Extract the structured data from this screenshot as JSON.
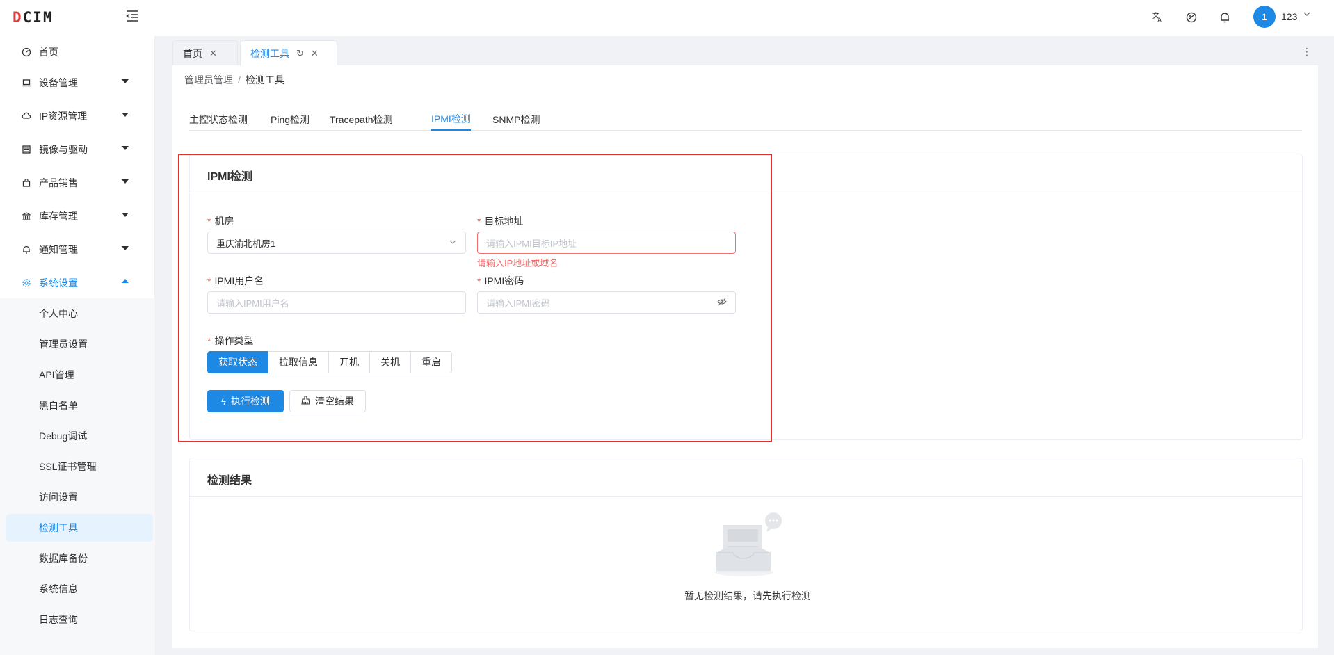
{
  "app": {
    "logo_text": "DCIM",
    "username": "123",
    "avatar_text": "1"
  },
  "header_icons": [
    "translate-icon",
    "theme-icon",
    "bell-icon"
  ],
  "sidebar": {
    "items": [
      {
        "label": "首页",
        "icon": "dashboard-icon"
      },
      {
        "label": "设备管理",
        "icon": "laptop-icon"
      },
      {
        "label": "IP资源管理",
        "icon": "cloud-icon"
      },
      {
        "label": "镜像与驱动",
        "icon": "image-icon"
      },
      {
        "label": "产品销售",
        "icon": "bag-icon"
      },
      {
        "label": "库存管理",
        "icon": "bank-icon"
      },
      {
        "label": "通知管理",
        "icon": "bell-icon"
      },
      {
        "label": "系统设置",
        "icon": "gear-icon"
      }
    ],
    "sub_items": [
      "个人中心",
      "管理员设置",
      "API管理",
      "黑白名单",
      "Debug调试",
      "SSL证书管理",
      "访问设置",
      "检测工具",
      "数据库备份",
      "系统信息",
      "日志查询"
    ]
  },
  "tabs": [
    {
      "label": "首页"
    },
    {
      "label": "检测工具"
    }
  ],
  "breadcrumb": {
    "parent": "管理员管理",
    "sep": "/",
    "current": "检测工具"
  },
  "tool_tabs": [
    "主控状态检测",
    "Ping检测",
    "Tracepath检测",
    "IPMI检测",
    "SNMP检测"
  ],
  "ipmi_card": {
    "title": "IPMI检测",
    "room_label": "机房",
    "room_value": "重庆渝北机房1",
    "target_label": "目标地址",
    "target_placeholder": "请输入IPMI目标IP地址",
    "target_error": "请输入IP地址或域名",
    "user_label": "IPMI用户名",
    "user_placeholder": "请输入IPMI用户名",
    "pass_label": "IPMI密码",
    "pass_placeholder": "请输入IPMI密码",
    "op_label": "操作类型",
    "ops": [
      "获取状态",
      "拉取信息",
      "开机",
      "关机",
      "重启"
    ],
    "run_label": "执行检测",
    "clear_label": "清空结果"
  },
  "result_card": {
    "title": "检测结果",
    "empty_text": "暂无检测结果，请先执行检测"
  },
  "colors": {
    "primary": "#1e88e5",
    "error": "#f56c6c",
    "highlight": "#e03030"
  }
}
